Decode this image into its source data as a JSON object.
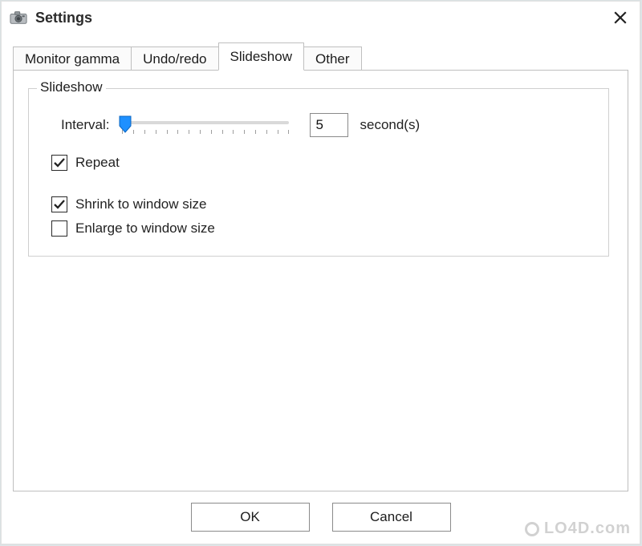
{
  "window": {
    "title": "Settings"
  },
  "tabs": {
    "monitor_gamma": "Monitor gamma",
    "undo_redo": "Undo/redo",
    "slideshow": "Slideshow",
    "other": "Other",
    "active": "slideshow"
  },
  "slideshow": {
    "group_label": "Slideshow",
    "interval_label": "Interval:",
    "interval_value": "5",
    "interval_unit": "second(s)",
    "repeat_label": "Repeat",
    "repeat_checked": true,
    "shrink_label": "Shrink to window size",
    "shrink_checked": true,
    "enlarge_label": "Enlarge to window size",
    "enlarge_checked": false
  },
  "buttons": {
    "ok": "OK",
    "cancel": "Cancel"
  },
  "watermark": "LO4D.com"
}
